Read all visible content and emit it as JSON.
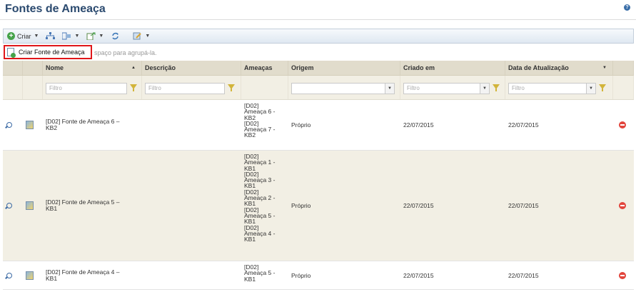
{
  "page": {
    "title": "Fontes de Ameaça"
  },
  "toolbar": {
    "create_label": "Criar"
  },
  "menu": {
    "create_item_label": "Criar Fonte de Ameaça"
  },
  "group_bar": {
    "hint": "spaço para agrupá-la."
  },
  "columns": {
    "name": "Nome",
    "description": "Descrição",
    "threats": "Ameaças",
    "origin": "Origem",
    "created": "Criado em",
    "updated": "Data de Atualização"
  },
  "filters": {
    "name_placeholder": "Filtro",
    "description_placeholder": "Filtro",
    "origin_value": "",
    "created_placeholder": "Filtro",
    "updated_placeholder": "Filtro"
  },
  "rows": [
    {
      "name": "[D02] Fonte de Ameaça 6 –\nKB2",
      "description": "",
      "threats": "[D02]\nAmeaça 6 -\nKB2\n[D02]\nAmeaça 7 -\nKB2",
      "origin": "Próprio",
      "created": "22/07/2015",
      "updated": "22/07/2015"
    },
    {
      "name": "[D02] Fonte de Ameaça 5 –\nKB1",
      "description": "",
      "threats": "[D02]\nAmeaça 1 -\nKB1\n[D02]\nAmeaça 3 -\nKB1\n[D02]\nAmeaça 2 -\nKB1\n[D02]\nAmeaça 5 -\nKB1\n[D02]\nAmeaça 4 -\nKB1",
      "origin": "Próprio",
      "created": "22/07/2015",
      "updated": "22/07/2015"
    },
    {
      "name": "[D02] Fonte de Ameaça 4 –\nKB1",
      "description": "",
      "threats": "[D02]\nAmeaça 5 -\nKB1",
      "origin": "Próprio",
      "created": "22/07/2015",
      "updated": "22/07/2015"
    }
  ],
  "colors": {
    "title": "#2b4a6f",
    "header_bg": "#e1dccc",
    "alt_row_bg": "#f2efe4",
    "highlight_border": "#e0161a"
  }
}
